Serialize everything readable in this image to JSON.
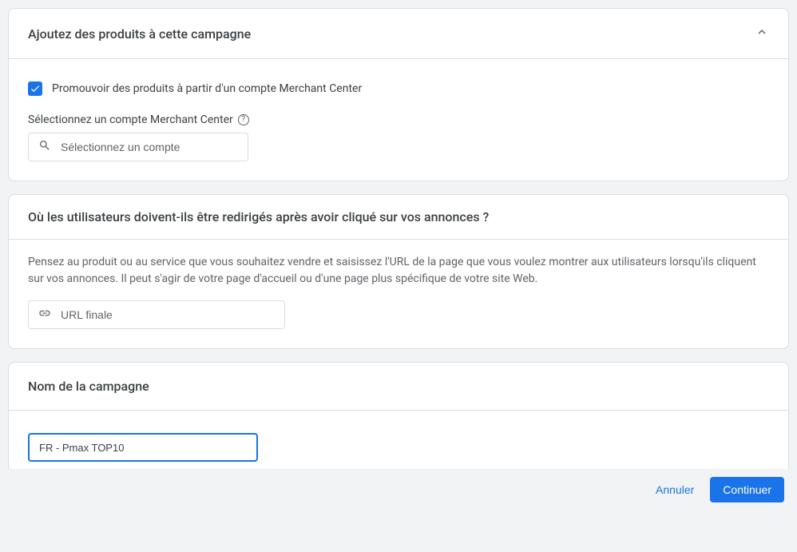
{
  "section1": {
    "title": "Ajoutez des produits à cette campagne",
    "checkbox_label": "Promouvoir des produits à partir d'un compte Merchant Center",
    "checkbox_checked": true,
    "select_label": "Sélectionnez un compte Merchant Center",
    "account_input_placeholder": "Sélectionnez un compte"
  },
  "section2": {
    "title": "Où les utilisateurs doivent-ils être redirigés après avoir cliqué sur vos annonces ?",
    "description": "Pensez au produit ou au service que vous souhaitez vendre et saisissez l'URL de la page que vous voulez montrer aux utilisateurs lorsqu'ils cliquent sur vos annonces. Il peut s'agir de votre page d'accueil ou d'une page plus spécifique de votre site Web.",
    "url_placeholder": "URL finale"
  },
  "section3": {
    "title": "Nom de la campagne",
    "name_value": "FR - Pmax TOP10"
  },
  "footer": {
    "cancel": "Annuler",
    "continue": "Continuer"
  }
}
